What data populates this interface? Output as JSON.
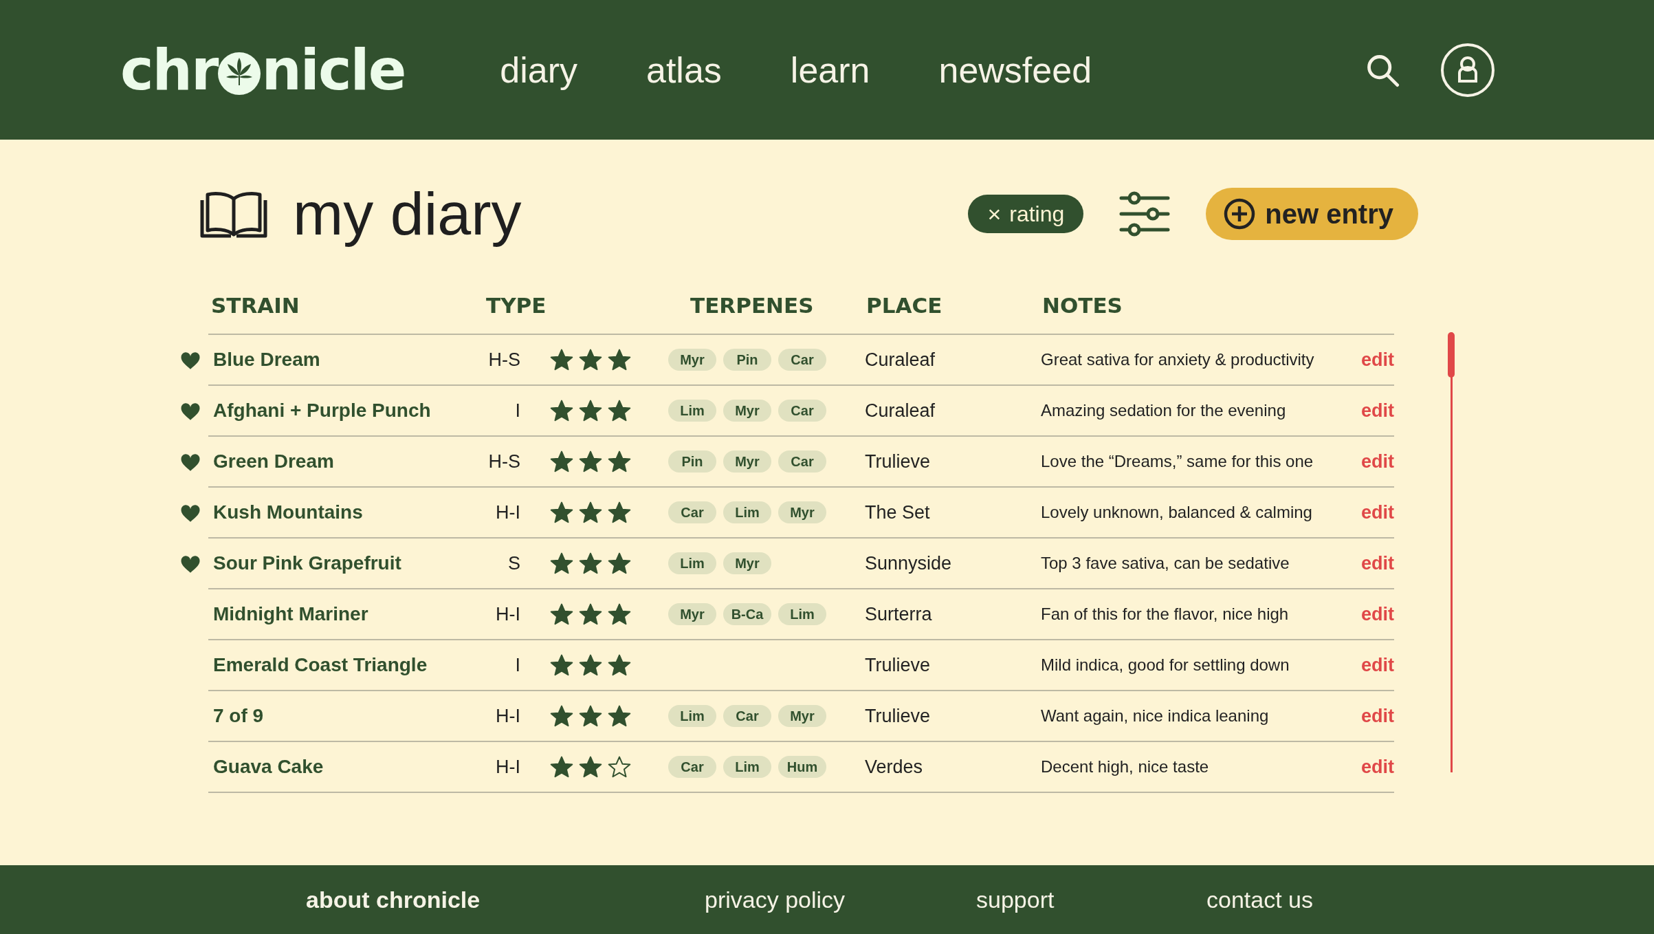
{
  "header": {
    "logo_start": "chr",
    "logo_end": "nicle",
    "nav": [
      {
        "label": "diary"
      },
      {
        "label": "atlas"
      },
      {
        "label": "learn"
      },
      {
        "label": "newsfeed"
      }
    ]
  },
  "page": {
    "title": "my diary",
    "filter_chip": {
      "icon": "×",
      "label": "rating"
    },
    "new_entry_button": "new entry"
  },
  "table": {
    "columns": [
      "STRAIN",
      "TYPE",
      "TERPENES",
      "PLACE",
      "NOTES"
    ],
    "rows": [
      {
        "favorite": true,
        "strain": "Blue Dream",
        "type": "H-S",
        "stars": 3,
        "terpenes": [
          "Myr",
          "Pin",
          "Car"
        ],
        "place": "Curaleaf",
        "notes": "Great sativa for anxiety & productivity",
        "action": "edit"
      },
      {
        "favorite": true,
        "strain": "Afghani + Purple Punch",
        "type": "I",
        "stars": 3,
        "terpenes": [
          "Lim",
          "Myr",
          "Car"
        ],
        "place": "Curaleaf",
        "notes": "Amazing sedation for the evening",
        "action": "edit"
      },
      {
        "favorite": true,
        "strain": "Green Dream",
        "type": "H-S",
        "stars": 3,
        "terpenes": [
          "Pin",
          "Myr",
          "Car"
        ],
        "place": "Trulieve",
        "notes": "Love the “Dreams,” same for this one",
        "action": "edit"
      },
      {
        "favorite": true,
        "strain": "Kush Mountains",
        "type": "H-I",
        "stars": 3,
        "terpenes": [
          "Car",
          "Lim",
          "Myr"
        ],
        "place": "The Set",
        "notes": "Lovely unknown, balanced & calming",
        "action": "edit"
      },
      {
        "favorite": true,
        "strain": "Sour Pink Grapefruit",
        "type": "S",
        "stars": 3,
        "terpenes": [
          "Lim",
          "Myr"
        ],
        "place": "Sunnyside",
        "notes": "Top 3 fave sativa, can be sedative",
        "action": "edit"
      },
      {
        "favorite": false,
        "strain": "Midnight Mariner",
        "type": "H-I",
        "stars": 3,
        "terpenes": [
          "Myr",
          "B-Ca",
          "Lim"
        ],
        "place": "Surterra",
        "notes": "Fan of this for the flavor, nice high",
        "action": "edit"
      },
      {
        "favorite": false,
        "strain": "Emerald Coast Triangle",
        "type": "I",
        "stars": 3,
        "place": "Trulieve",
        "notes": "Mild indica, good for settling down",
        "action": "edit"
      },
      {
        "favorite": false,
        "strain": "7 of 9",
        "type": "H-I",
        "stars": 3,
        "terpenes": [
          "Lim",
          "Car",
          "Myr"
        ],
        "place": "Trulieve",
        "notes": "Want again, nice indica leaning",
        "action": "edit"
      },
      {
        "favorite": false,
        "strain": "Guava Cake",
        "type": "H-I",
        "stars": 2,
        "terpenes": [
          "Car",
          "Lim",
          "Hum"
        ],
        "place": "Verdes",
        "notes": "Decent high, nice taste",
        "action": "edit"
      }
    ]
  },
  "footer": {
    "links": [
      {
        "label": "about chronicle",
        "bold": true
      },
      {
        "label": "privacy policy",
        "bold": false
      },
      {
        "label": "support",
        "bold": false
      },
      {
        "label": "contact us",
        "bold": false
      }
    ]
  }
}
